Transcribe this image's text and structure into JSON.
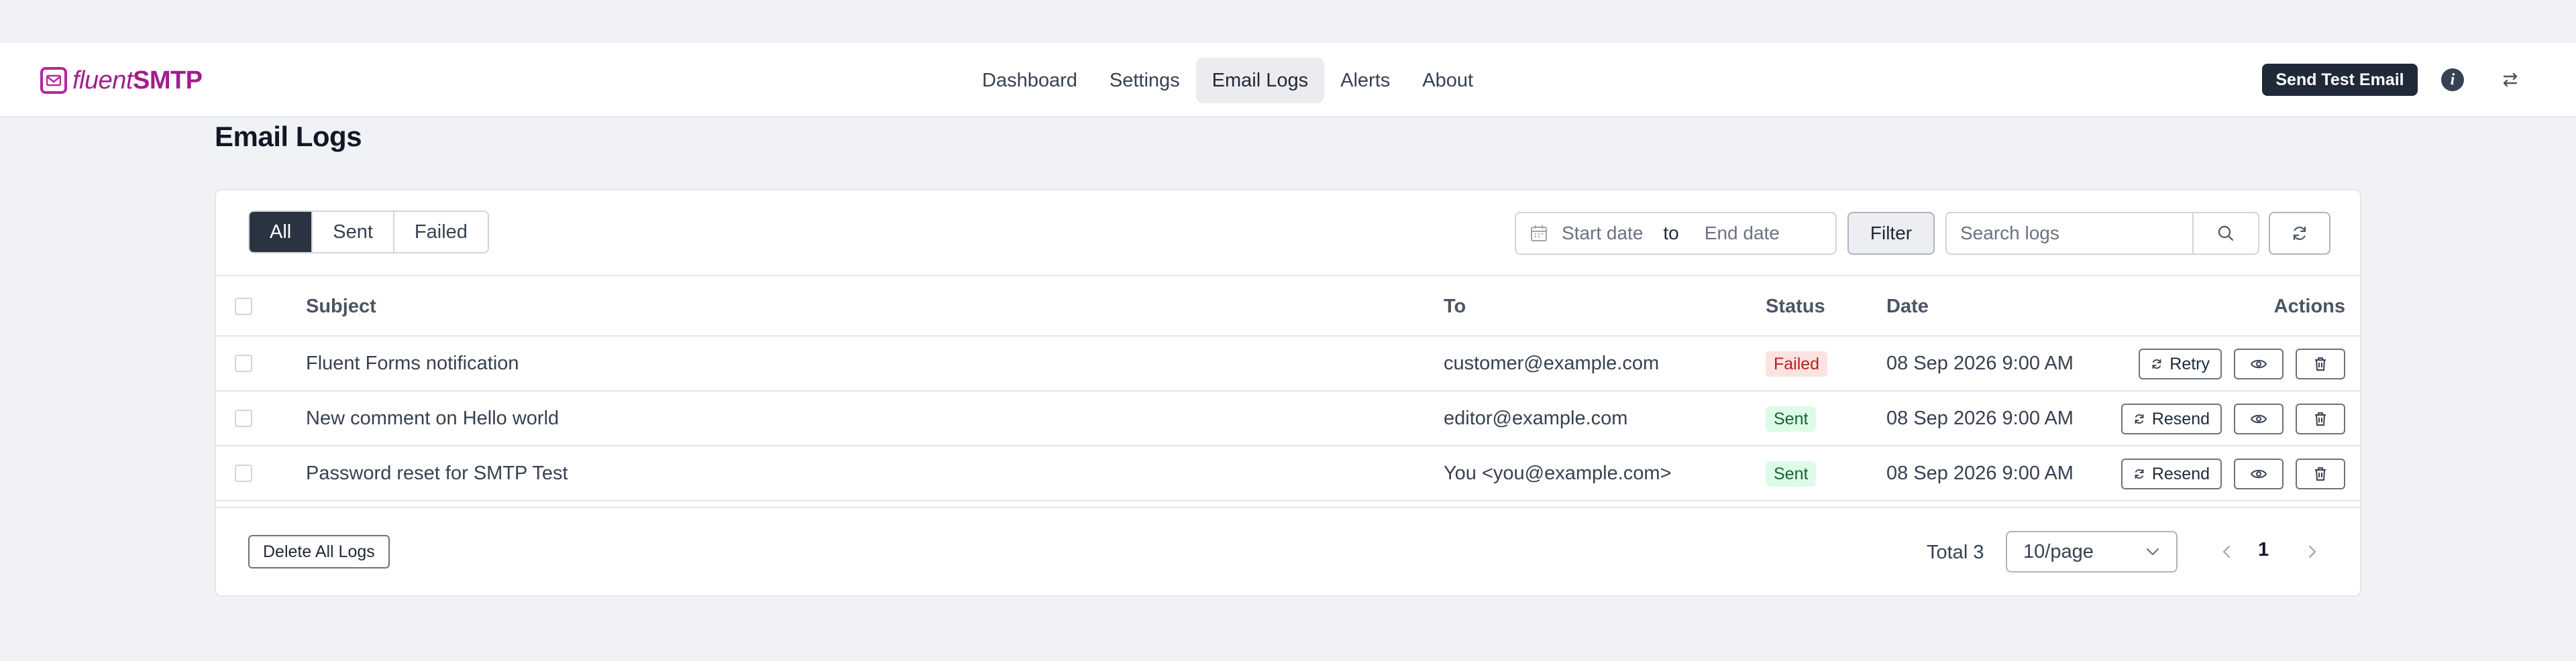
{
  "app": {
    "logo_fluent": "fluent",
    "logo_smtp": "SMTP"
  },
  "nav": {
    "items": [
      {
        "label": "Dashboard"
      },
      {
        "label": "Settings"
      },
      {
        "label": "Email Logs",
        "active": true
      },
      {
        "label": "Alerts"
      },
      {
        "label": "About"
      }
    ]
  },
  "header": {
    "send_test_label": "Send Test Email",
    "info_icon": "info-icon",
    "settings_icon": "sliders-icon"
  },
  "page": {
    "title": "Email Logs"
  },
  "filters": {
    "tabs": [
      {
        "label": "All",
        "active": true
      },
      {
        "label": "Sent"
      },
      {
        "label": "Failed"
      }
    ],
    "start_placeholder": "Start date",
    "range_separator": "to",
    "end_placeholder": "End date",
    "filter_label": "Filter",
    "search_placeholder": "Search logs"
  },
  "table": {
    "headers": {
      "subject": "Subject",
      "to": "To",
      "status": "Status",
      "date": "Date",
      "actions": "Actions"
    },
    "rows": [
      {
        "subject": "Fluent Forms notification",
        "to": "customer@example.com",
        "status": "Failed",
        "date": "08 Sep 2026 9:00 AM",
        "action": "Retry"
      },
      {
        "subject": "New comment on Hello world",
        "to": "editor@example.com",
        "status": "Sent",
        "date": "08 Sep 2026 9:00 AM",
        "action": "Resend"
      },
      {
        "subject": "Password reset for SMTP Test",
        "to": "You <you@example.com>",
        "status": "Sent",
        "date": "08 Sep 2026 9:00 AM",
        "action": "Resend"
      }
    ]
  },
  "footer": {
    "delete_all_label": "Delete All Logs",
    "total_label": "Total 3",
    "page_size": "10/page",
    "current_page": "1"
  },
  "colors": {
    "brand": "#a21e8c",
    "dark": "#1f2937",
    "failed_bg": "#fde2e2",
    "sent_bg": "#dcfce7"
  }
}
